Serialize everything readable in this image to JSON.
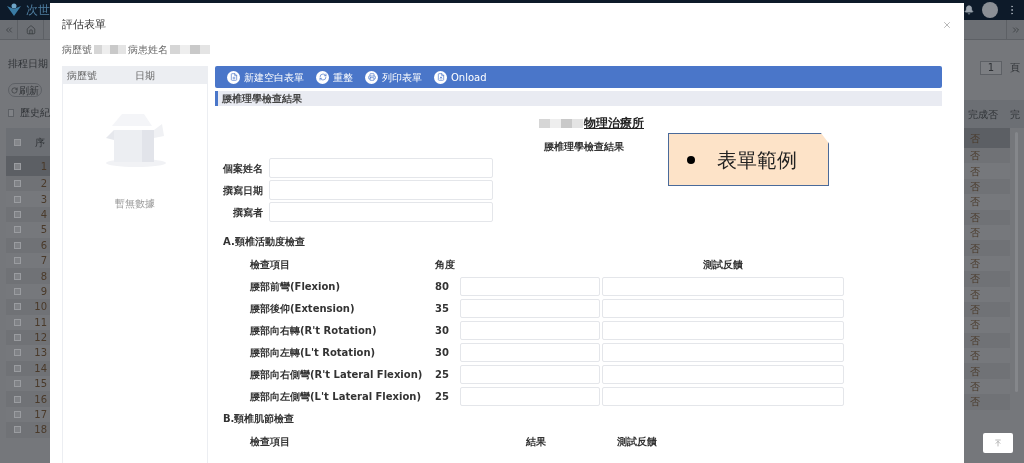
{
  "app": {
    "brand": "次世",
    "schedule_label": "排程日期",
    "refresh_button": "刷新",
    "history": {
      "label": "歷史紀",
      "checked": false
    },
    "page_input": "1",
    "page_unit": "頁",
    "table": {
      "columns": [
        "序",
        "完成否",
        "完"
      ],
      "all_checked": false,
      "rows": [
        {
          "index": "1",
          "done": "否",
          "selected": true
        },
        {
          "index": "2",
          "done": "否",
          "selected": false
        },
        {
          "index": "3",
          "done": "否",
          "selected": false
        },
        {
          "index": "4",
          "done": "否",
          "selected": false
        },
        {
          "index": "5",
          "done": "否",
          "selected": false
        },
        {
          "index": "6",
          "done": "否",
          "selected": false
        },
        {
          "index": "7",
          "done": "否",
          "selected": false
        },
        {
          "index": "8",
          "done": "否",
          "selected": false
        },
        {
          "index": "9",
          "done": "否",
          "selected": false
        },
        {
          "index": "10",
          "done": "否",
          "selected": false
        },
        {
          "index": "11",
          "done": "否",
          "selected": false
        },
        {
          "index": "12",
          "done": "否",
          "selected": false
        },
        {
          "index": "13",
          "done": "否",
          "selected": false
        },
        {
          "index": "14",
          "done": "否",
          "selected": false
        },
        {
          "index": "15",
          "done": "否",
          "selected": false
        },
        {
          "index": "16",
          "done": "否",
          "selected": false
        },
        {
          "index": "17",
          "done": "否",
          "selected": false
        },
        {
          "index": "18",
          "done": "否",
          "selected": false
        }
      ]
    }
  },
  "modal": {
    "title": "評估表單",
    "patient": [
      {
        "label": "病歷號"
      },
      {
        "label": "病患姓名"
      }
    ],
    "list": {
      "columns": [
        "病歷號",
        "日期"
      ],
      "empty_text": "暫無數據"
    },
    "toolbar": [
      {
        "label": "新建空白表單",
        "kind": "new"
      },
      {
        "label": "重整",
        "kind": "refresh"
      },
      {
        "label": "列印表單",
        "kind": "print"
      },
      {
        "label": "Onload",
        "kind": "upload"
      }
    ],
    "section_title": "腰椎理學檢查結果",
    "form": {
      "clinic_name": "物理治療所",
      "heading": "腰椎理學檢查結果",
      "fields": [
        {
          "label": "個案姓名"
        },
        {
          "label": "撰寫日期"
        },
        {
          "label": "撰寫者"
        }
      ],
      "sections": [
        {
          "title": "A.頸椎活動度檢查",
          "kind": "angle",
          "columns": [
            "檢查項目",
            "角度",
            "測試反饋"
          ],
          "rows": [
            {
              "item": "腰部前彎(Flexion)",
              "value": "80"
            },
            {
              "item": "腰部後仰(Extension)",
              "value": "35"
            },
            {
              "item": "腰部向右轉(R't Rotation)",
              "value": "30"
            },
            {
              "item": "腰部向左轉(L't Rotation)",
              "value": "30"
            },
            {
              "item": "腰部向右側彎(R't Lateral Flexion)",
              "value": "25"
            },
            {
              "item": "腰部向左側彎(L't Lateral Flexion)",
              "value": "25"
            }
          ]
        },
        {
          "title": "B.頸椎肌節檢查",
          "kind": "result",
          "columns": [
            "檢查項目",
            "結果",
            "測試反饋"
          ]
        }
      ]
    }
  },
  "callout": {
    "text": "表單範例"
  }
}
